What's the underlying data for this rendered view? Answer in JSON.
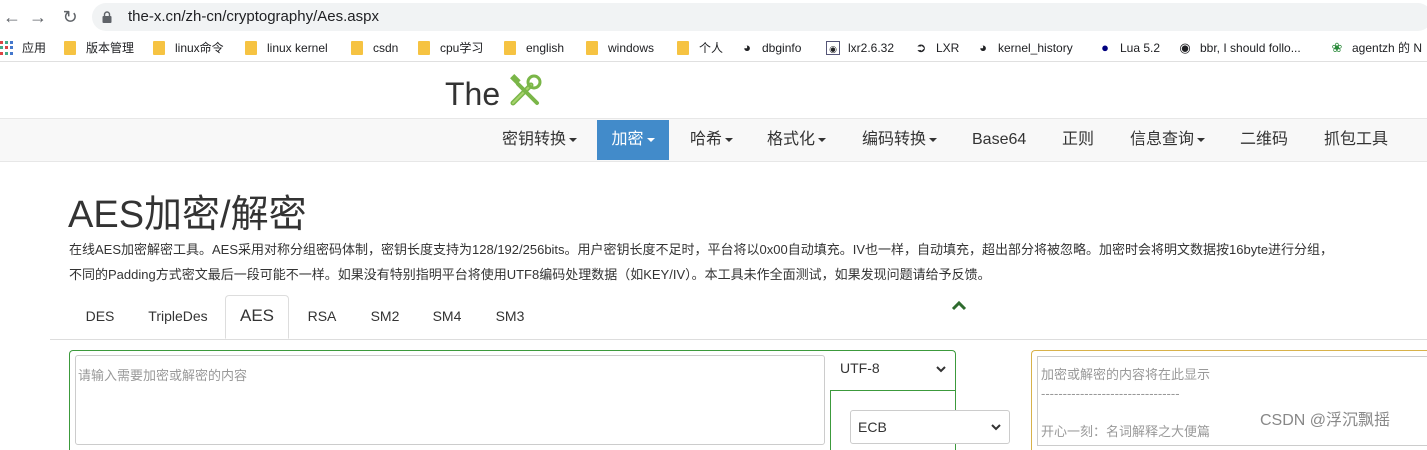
{
  "browser": {
    "url": "the-x.cn/zh-cn/cryptography/Aes.aspx"
  },
  "bookmarks": [
    {
      "label": "应用",
      "icon": "apps-grid-icon"
    },
    {
      "label": "版本管理",
      "icon": "folder-icon"
    },
    {
      "label": "linux命令",
      "icon": "folder-icon"
    },
    {
      "label": "linux kernel",
      "icon": "folder-icon"
    },
    {
      "label": "csdn",
      "icon": "folder-icon"
    },
    {
      "label": "cpu学习",
      "icon": "folder-icon"
    },
    {
      "label": "english",
      "icon": "folder-icon"
    },
    {
      "label": "windows",
      "icon": "folder-icon"
    },
    {
      "label": "个人",
      "icon": "folder-icon"
    },
    {
      "label": "dbginfo",
      "icon": "globe-icon"
    },
    {
      "label": "lxr2.6.32",
      "icon": "page-icon"
    },
    {
      "label": "LXR",
      "icon": "arrow-icon"
    },
    {
      "label": "kernel_history",
      "icon": "globe-icon"
    },
    {
      "label": "Lua 5.2",
      "icon": "lua-icon"
    },
    {
      "label": "bbr, I should follo...",
      "icon": "github-icon"
    },
    {
      "label": "agentzh 的 N",
      "icon": "leaf-icon"
    }
  ],
  "site": {
    "logo_text": "The"
  },
  "nav": {
    "items": [
      {
        "label": "密钥转换",
        "dropdown": true
      },
      {
        "label": "加密",
        "dropdown": true,
        "active": true
      },
      {
        "label": "哈希",
        "dropdown": true
      },
      {
        "label": "格式化",
        "dropdown": true
      },
      {
        "label": "编码转换",
        "dropdown": true
      },
      {
        "label": "Base64",
        "dropdown": false
      },
      {
        "label": "正则",
        "dropdown": false
      },
      {
        "label": "信息查询",
        "dropdown": true
      },
      {
        "label": "二维码",
        "dropdown": false
      },
      {
        "label": "抓包工具",
        "dropdown": false
      }
    ],
    "active_color": "#428bca"
  },
  "main": {
    "title": "AES加密/解密",
    "description": [
      "在线AES加密解密工具。AES采用对称分组密码体制，密钥长度支持为128/192/256bits。用户密钥长度不足时，平台将以0x00自动填充。IV也一样，自动填充，超出部分将被忽略。加密时会将明文数据按16byte进行分组，",
      "不同的Padding方式密文最后一段可能不一样。如果没有特别指明平台将使用UTF8编码处理数据（如KEY/IV）。本工具未作全面测试，如果发现问题请给予反馈。"
    ],
    "tabs": [
      {
        "label": "DES"
      },
      {
        "label": "TripleDes"
      },
      {
        "label": "AES",
        "active": true
      },
      {
        "label": "RSA"
      },
      {
        "label": "SM2"
      },
      {
        "label": "SM4"
      },
      {
        "label": "SM3"
      }
    ]
  },
  "form": {
    "input_placeholder": "请输入需要加密或解密的内容",
    "encoding_value": "UTF-8",
    "mode_value": "ECB",
    "output_lines": "加密或解密的内容将在此显示\n--------------------------------\n\n开心一刻：名词解释之大便篇"
  },
  "watermark": "CSDN @浮沉飘摇"
}
